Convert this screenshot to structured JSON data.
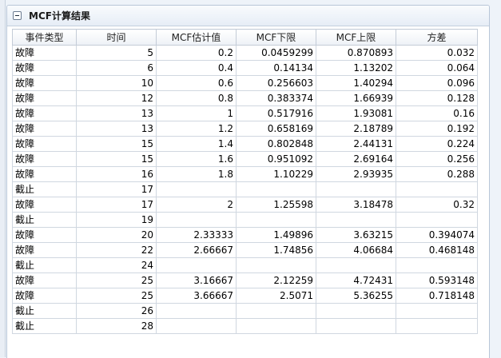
{
  "panel": {
    "title": "MCF计算结果"
  },
  "table": {
    "headers": [
      "事件类型",
      "时间",
      "MCF估计值",
      "MCF下限",
      "MCF上限",
      "方差"
    ],
    "rows": [
      [
        "故障",
        "5",
        "0.2",
        "0.0459299",
        "0.870893",
        "0.032"
      ],
      [
        "故障",
        "6",
        "0.4",
        "0.14134",
        "1.13202",
        "0.064"
      ],
      [
        "故障",
        "10",
        "0.6",
        "0.256603",
        "1.40294",
        "0.096"
      ],
      [
        "故障",
        "12",
        "0.8",
        "0.383374",
        "1.66939",
        "0.128"
      ],
      [
        "故障",
        "13",
        "1",
        "0.517916",
        "1.93081",
        "0.16"
      ],
      [
        "故障",
        "13",
        "1.2",
        "0.658169",
        "2.18789",
        "0.192"
      ],
      [
        "故障",
        "15",
        "1.4",
        "0.802848",
        "2.44131",
        "0.224"
      ],
      [
        "故障",
        "15",
        "1.6",
        "0.951092",
        "2.69164",
        "0.256"
      ],
      [
        "故障",
        "16",
        "1.8",
        "1.10229",
        "2.93935",
        "0.288"
      ],
      [
        "截止",
        "17",
        "",
        "",
        "",
        ""
      ],
      [
        "故障",
        "17",
        "2",
        "1.25598",
        "3.18478",
        "0.32"
      ],
      [
        "截止",
        "19",
        "",
        "",
        "",
        ""
      ],
      [
        "故障",
        "20",
        "2.33333",
        "1.49896",
        "3.63215",
        "0.394074"
      ],
      [
        "故障",
        "22",
        "2.66667",
        "1.74856",
        "4.06684",
        "0.468148"
      ],
      [
        "截止",
        "24",
        "",
        "",
        "",
        ""
      ],
      [
        "故障",
        "25",
        "3.16667",
        "2.12259",
        "4.72431",
        "0.593148"
      ],
      [
        "故障",
        "25",
        "3.66667",
        "2.5071",
        "5.36255",
        "0.718148"
      ],
      [
        "截止",
        "26",
        "",
        "",
        "",
        ""
      ],
      [
        "截止",
        "28",
        "",
        "",
        "",
        ""
      ]
    ]
  }
}
